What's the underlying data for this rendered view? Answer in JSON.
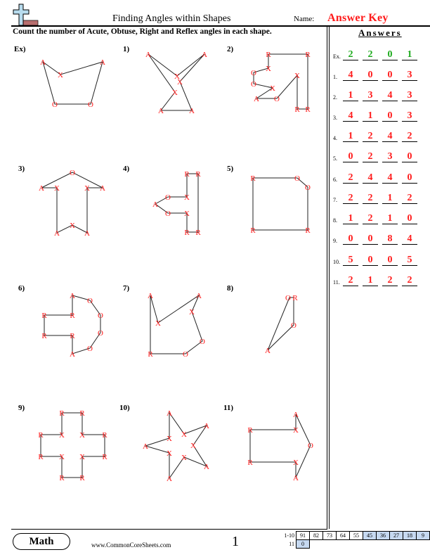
{
  "header": {
    "title": "Finding Angles within Shapes",
    "name_label": "Name:",
    "name_value": "Answer Key"
  },
  "instructions": "Count the number of Acute, Obtuse, Right and Reflex angles in each shape.",
  "answers": {
    "title": "Answers",
    "rows": [
      {
        "label": "Ex.",
        "values": [
          "2",
          "2",
          "0",
          "1"
        ]
      },
      {
        "label": "1.",
        "values": [
          "4",
          "0",
          "0",
          "3"
        ]
      },
      {
        "label": "2.",
        "values": [
          "1",
          "3",
          "4",
          "3"
        ]
      },
      {
        "label": "3.",
        "values": [
          "4",
          "1",
          "0",
          "3"
        ]
      },
      {
        "label": "4.",
        "values": [
          "1",
          "2",
          "4",
          "2"
        ]
      },
      {
        "label": "5.",
        "values": [
          "0",
          "2",
          "3",
          "0"
        ]
      },
      {
        "label": "6.",
        "values": [
          "2",
          "4",
          "4",
          "0"
        ]
      },
      {
        "label": "7.",
        "values": [
          "2",
          "2",
          "1",
          "2"
        ]
      },
      {
        "label": "8.",
        "values": [
          "1",
          "2",
          "1",
          "0"
        ]
      },
      {
        "label": "9.",
        "values": [
          "0",
          "0",
          "8",
          "4"
        ]
      },
      {
        "label": "10.",
        "values": [
          "5",
          "0",
          "0",
          "5"
        ]
      },
      {
        "label": "11.",
        "values": [
          "2",
          "1",
          "2",
          "2"
        ]
      }
    ],
    "example_color": "#1aaa1a",
    "answer_color": "#ff1a1a"
  },
  "problems": [
    {
      "number": "Ex)",
      "vertex_labels": [
        "A",
        "X",
        "A",
        "O",
        "O"
      ]
    },
    {
      "number": "1)",
      "vertex_labels": [
        "A",
        "X",
        "A",
        "X",
        "A",
        "A",
        "X"
      ]
    },
    {
      "number": "2)",
      "vertex_labels": [
        "R",
        "R",
        "R",
        "R",
        "X",
        "O",
        "A",
        "X",
        "O",
        "O",
        "X"
      ]
    },
    {
      "number": "3)",
      "vertex_labels": [
        "O",
        "A",
        "X",
        "A",
        "X",
        "A",
        "X",
        "A"
      ]
    },
    {
      "number": "4)",
      "vertex_labels": [
        "R",
        "R",
        "R",
        "R",
        "X",
        "O",
        "A",
        "O",
        "X"
      ]
    },
    {
      "number": "5)",
      "vertex_labels": [
        "R",
        "O",
        "O",
        "R",
        "R"
      ]
    },
    {
      "number": "6)",
      "vertex_labels": [
        "A",
        "O",
        "O",
        "O",
        "O",
        "A",
        "R",
        "R",
        "R",
        "R"
      ]
    },
    {
      "number": "7)",
      "vertex_labels": [
        "A",
        "X",
        "A",
        "X",
        "O",
        "O",
        "R"
      ]
    },
    {
      "number": "8)",
      "vertex_labels": [
        "O",
        "R",
        "O",
        "A"
      ]
    },
    {
      "number": "9)",
      "vertex_labels": [
        "R",
        "R",
        "X",
        "R",
        "R",
        "X",
        "R",
        "R",
        "X",
        "R",
        "R",
        "X"
      ]
    },
    {
      "number": "10)",
      "vertex_labels": [
        "A",
        "X",
        "A",
        "X",
        "A",
        "X",
        "A",
        "X",
        "A",
        "X"
      ]
    },
    {
      "number": "11)",
      "vertex_labels": [
        "A",
        "O",
        "A",
        "X",
        "R",
        "R",
        "X"
      ]
    }
  ],
  "footer": {
    "subject": "Math",
    "url": "www.CommonCoreSheets.com",
    "page_number": "1",
    "score_rows": [
      {
        "label": "1-10",
        "cells": [
          "91",
          "82",
          "73",
          "64",
          "55",
          "45",
          "36",
          "27",
          "18",
          "9"
        ]
      },
      {
        "label": "11",
        "cells": [
          "0"
        ]
      }
    ]
  }
}
